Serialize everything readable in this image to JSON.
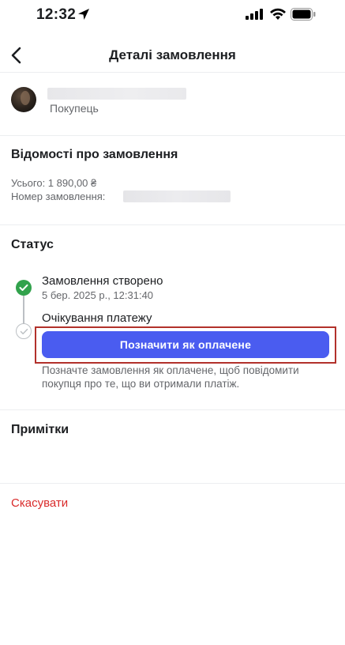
{
  "status_bar": {
    "time": "12:32"
  },
  "header": {
    "title": "Деталі замовлення"
  },
  "buyer": {
    "role": "Покупець"
  },
  "order_info": {
    "title": "Відомості про замовлення",
    "total": "Усього: 1 890,00 ₴",
    "order_number_label": "Номер замовлення:"
  },
  "status": {
    "title": "Статус",
    "steps": [
      {
        "title": "Замовлення створено",
        "timestamp": "5 бер. 2025 р., 12:31:40",
        "done": true
      },
      {
        "title": "Очікування платежу",
        "done": false
      }
    ],
    "mark_paid_button": "Позначити як оплачене",
    "hint": "Позначте замовлення як оплачене, щоб повідомити покупця про те, що ви отримали платіж."
  },
  "notes": {
    "title": "Примітки"
  },
  "cancel_label": "Скасувати",
  "colors": {
    "accent": "#4a5cf0",
    "success": "#31a24c",
    "danger": "#d92b2b",
    "highlight": "#b2312b"
  },
  "icons": [
    "location-arrow-icon",
    "signal-icon",
    "wifi-icon",
    "battery-icon",
    "back-chevron-icon",
    "check-done-icon",
    "check-pending-icon"
  ]
}
